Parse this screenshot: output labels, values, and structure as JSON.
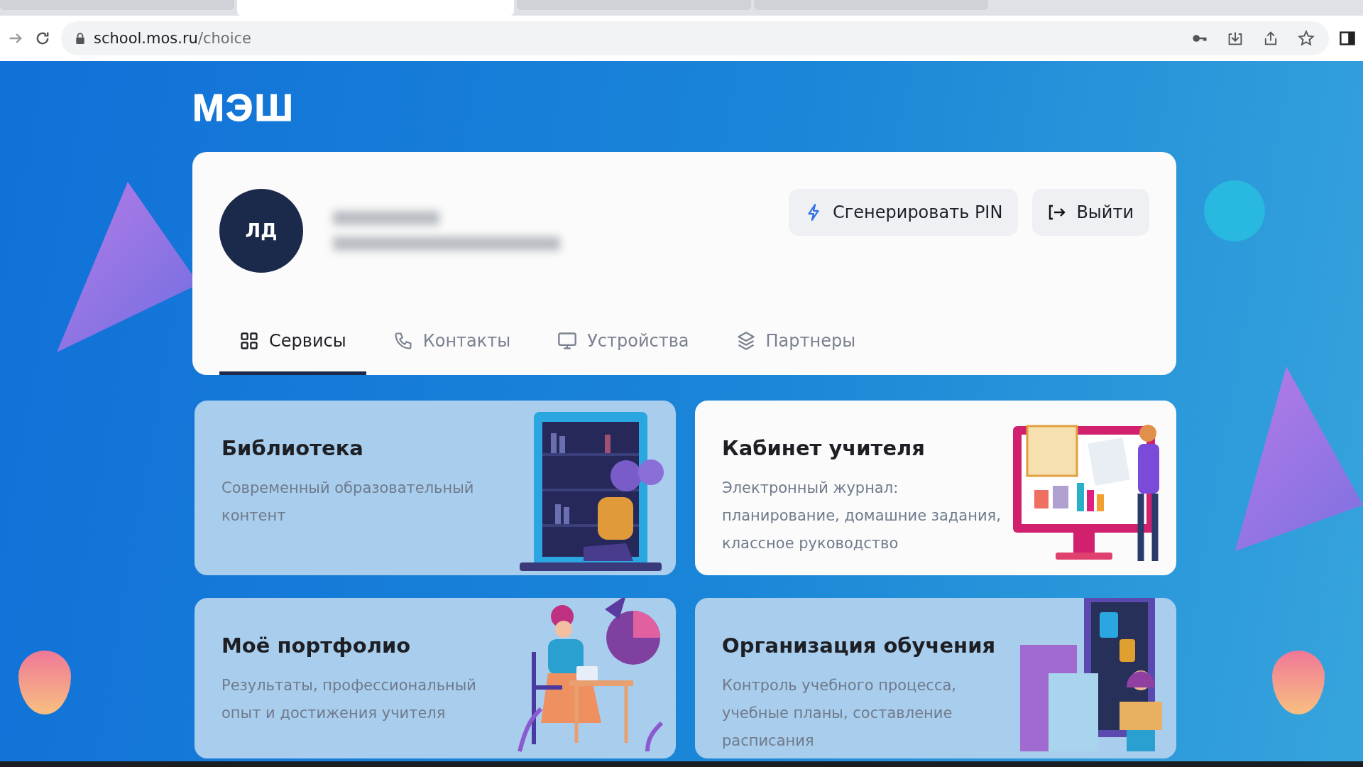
{
  "browser": {
    "tabs": [
      {
        "selected": false
      },
      {
        "selected": true
      },
      {
        "selected": false
      },
      {
        "selected": false
      }
    ],
    "url_host": "school.mos.ru",
    "url_path": "/choice"
  },
  "logo": "МЭШ",
  "profile": {
    "initials": "ЛД"
  },
  "actions": [
    {
      "kind": "pin",
      "label": "Сгенерировать PIN"
    },
    {
      "kind": "logout",
      "label": "Выйти"
    }
  ],
  "tabs": [
    {
      "label": "Сервисы",
      "selected": true
    },
    {
      "label": "Контакты",
      "selected": false
    },
    {
      "label": "Устройства",
      "selected": false
    },
    {
      "label": "Партнеры",
      "selected": false
    }
  ],
  "services": [
    {
      "title": "Библиотека",
      "description": "Современный образовательный контент",
      "hovered": false
    },
    {
      "title": "Кабинет учителя",
      "description": "Электронный журнал: планирование, домашние задания, классное руководство",
      "hovered": true
    },
    {
      "title": "Моё портфолио",
      "description": "Результаты, профессиональный опыт и достижения учителя",
      "hovered": false
    },
    {
      "title": "Организация обучения",
      "description": "Контроль учебного процесса, учебные планы, составление расписания",
      "hovered": false
    }
  ]
}
